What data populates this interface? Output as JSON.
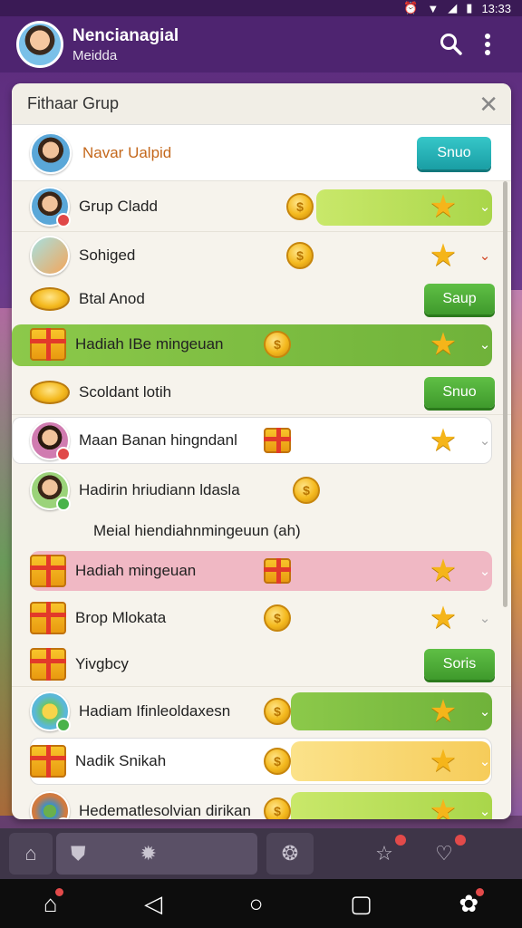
{
  "status": {
    "time": "13:33"
  },
  "header": {
    "title": "Nencianagial",
    "subtitle": "Meidda"
  },
  "panel": {
    "title": "Fithaar Grup"
  },
  "top_row": {
    "name": "Navar Ualpid",
    "button": "Snuo"
  },
  "rows": [
    {
      "label": "Grup Cladd"
    },
    {
      "label": "Sohiged"
    },
    {
      "label": "Btal Anod",
      "button": "Saup"
    },
    {
      "label": "Hadiah IBe mingeuan"
    },
    {
      "label": "Scoldant lotih",
      "button": "Snuo"
    },
    {
      "label": "Maan Banan hingndanl"
    },
    {
      "label": "Hadirin hriudiann ldasla"
    },
    {
      "label": "Meial hiendiahnmingeuun (ah)"
    },
    {
      "label": "Hadiah mingeuan"
    },
    {
      "label": "Brop Mlokata"
    },
    {
      "label": "Yivgbcy",
      "button": "Soris"
    },
    {
      "label": "Hadiam Ifinleoldaxesn"
    },
    {
      "label": "Nadik Snikah"
    },
    {
      "label": "Hedematlesolvian dirikan"
    }
  ],
  "icons": {
    "coin": "$",
    "star": "★",
    "chevron": "⌄"
  },
  "colors": {
    "accent_green": "#5fbf45",
    "accent_teal": "#36c7c9",
    "header_bg": "#4e2470"
  }
}
